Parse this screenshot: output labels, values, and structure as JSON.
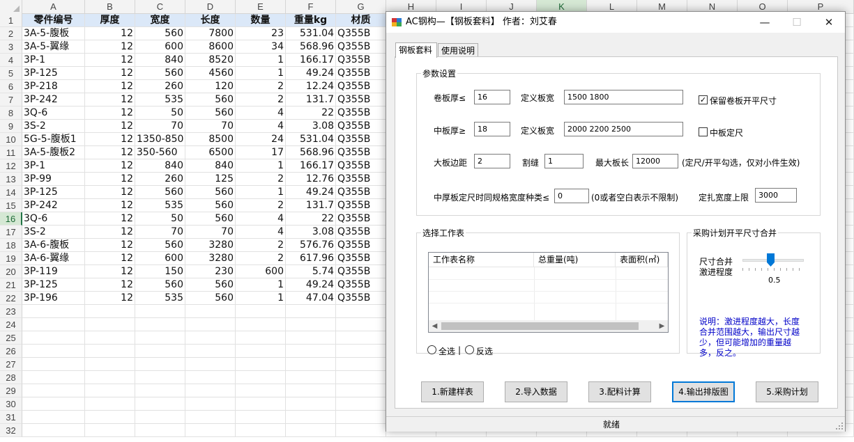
{
  "spreadsheet": {
    "columns": [
      "A",
      "B",
      "C",
      "D",
      "E",
      "F",
      "G",
      "H",
      "I",
      "J",
      "K",
      "L",
      "M",
      "N",
      "O",
      "P"
    ],
    "selected_column": "K",
    "selected_row": 16,
    "headers": [
      "零件编号",
      "厚度",
      "宽度",
      "长度",
      "数量",
      "重量kg",
      "材质"
    ],
    "rows": [
      [
        "3A-5-腹板",
        "12",
        "560",
        "7800",
        "23",
        "531.04",
        "Q355B"
      ],
      [
        "3A-5-翼缘",
        "12",
        "600",
        "8600",
        "34",
        "568.96",
        "Q355B"
      ],
      [
        "3P-1",
        "12",
        "840",
        "8520",
        "1",
        "166.17",
        "Q355B"
      ],
      [
        "3P-125",
        "12",
        "560",
        "4560",
        "1",
        "49.24",
        "Q355B"
      ],
      [
        "3P-218",
        "12",
        "260",
        "120",
        "2",
        "12.24",
        "Q355B"
      ],
      [
        "3P-242",
        "12",
        "535",
        "560",
        "2",
        "131.7",
        "Q355B"
      ],
      [
        "3Q-6",
        "12",
        "50",
        "560",
        "4",
        "22",
        "Q355B"
      ],
      [
        "3S-2",
        "12",
        "70",
        "70",
        "4",
        "3.08",
        "Q355B"
      ],
      [
        "5G-5-腹板1",
        "12",
        "1350-850",
        "8500",
        "24",
        "531.04",
        "Q355B"
      ],
      [
        "3A-5-腹板2",
        "12",
        "350-560",
        "6500",
        "17",
        "568.96",
        "Q355B"
      ],
      [
        "3P-1",
        "12",
        "840",
        "840",
        "1",
        "166.17",
        "Q355B"
      ],
      [
        "3P-99",
        "12",
        "260",
        "125",
        "2",
        "12.76",
        "Q355B"
      ],
      [
        "3P-125",
        "12",
        "560",
        "560",
        "1",
        "49.24",
        "Q355B"
      ],
      [
        "3P-242",
        "12",
        "535",
        "560",
        "2",
        "131.7",
        "Q355B"
      ],
      [
        "3Q-6",
        "12",
        "50",
        "560",
        "4",
        "22",
        "Q355B"
      ],
      [
        "3S-2",
        "12",
        "70",
        "70",
        "4",
        "3.08",
        "Q355B"
      ],
      [
        "3A-6-腹板",
        "12",
        "560",
        "3280",
        "2",
        "576.76",
        "Q355B"
      ],
      [
        "3A-6-翼缘",
        "12",
        "600",
        "3280",
        "2",
        "617.96",
        "Q355B"
      ],
      [
        "3P-119",
        "12",
        "150",
        "230",
        "600",
        "5.74",
        "Q355B"
      ],
      [
        "3P-125",
        "12",
        "560",
        "560",
        "1",
        "49.24",
        "Q355B"
      ],
      [
        "3P-196",
        "12",
        "535",
        "560",
        "1",
        "47.04",
        "Q355B"
      ]
    ],
    "total_row_numbers": 32
  },
  "window": {
    "title": "AC钢构—【钢板套料】  作者：刘艾春",
    "minimize": "—",
    "maximize": "☐",
    "close": "✕",
    "tabs": [
      "钢板套料",
      "使用说明"
    ],
    "params": {
      "group_title": "参数设置",
      "coil_thick_label": "卷板厚≤",
      "coil_thick_value": "16",
      "def_width_label_1": "定义板宽",
      "def_width_value_1": "1500 1800",
      "keep_coil_label": "保留卷板开平尺寸",
      "keep_coil_checked": true,
      "mid_thick_label": "中板厚≥",
      "mid_thick_value": "18",
      "def_width_label_2": "定义板宽",
      "def_width_value_2": "2000 2200 2500",
      "mid_fixed_label": "中板定尺",
      "mid_fixed_checked": false,
      "margin_label": "大板边距",
      "margin_value": "2",
      "kerf_label": "割缝",
      "kerf_value": "1",
      "max_len_label": "最大板长",
      "max_len_value": "12000",
      "max_len_note": "(定尺/开平勾选，仅对小件生效)",
      "width_types_label": "中厚板定尺时同规格宽度种类≤",
      "width_types_value": "0",
      "width_types_note": "(0或者空白表示不限制)",
      "rolled_width_label": "定扎宽度上限",
      "rolled_width_value": "3000"
    },
    "worksheet": {
      "group_title": "选择工作表",
      "columns": [
        "工作表名称",
        "总重量(吨)",
        "表面积(㎡)"
      ],
      "select_all": "全选",
      "invert": "反选"
    },
    "purchase": {
      "group_title": "采购计划开平尺寸合并",
      "slider_label_1": "尺寸合并",
      "slider_label_2": "激进程度",
      "slider_value": "0.5",
      "slider_level": 0.5,
      "note": "说明：激进程度越大，长度合并范围越大，输出尺寸越少，但可能增加的重量越多，反之。"
    },
    "buttons": [
      "1.新建样表",
      "2.导入数据",
      "3.配料计算",
      "4.输出排版图",
      "5.采购计划"
    ],
    "status": "就绪"
  }
}
